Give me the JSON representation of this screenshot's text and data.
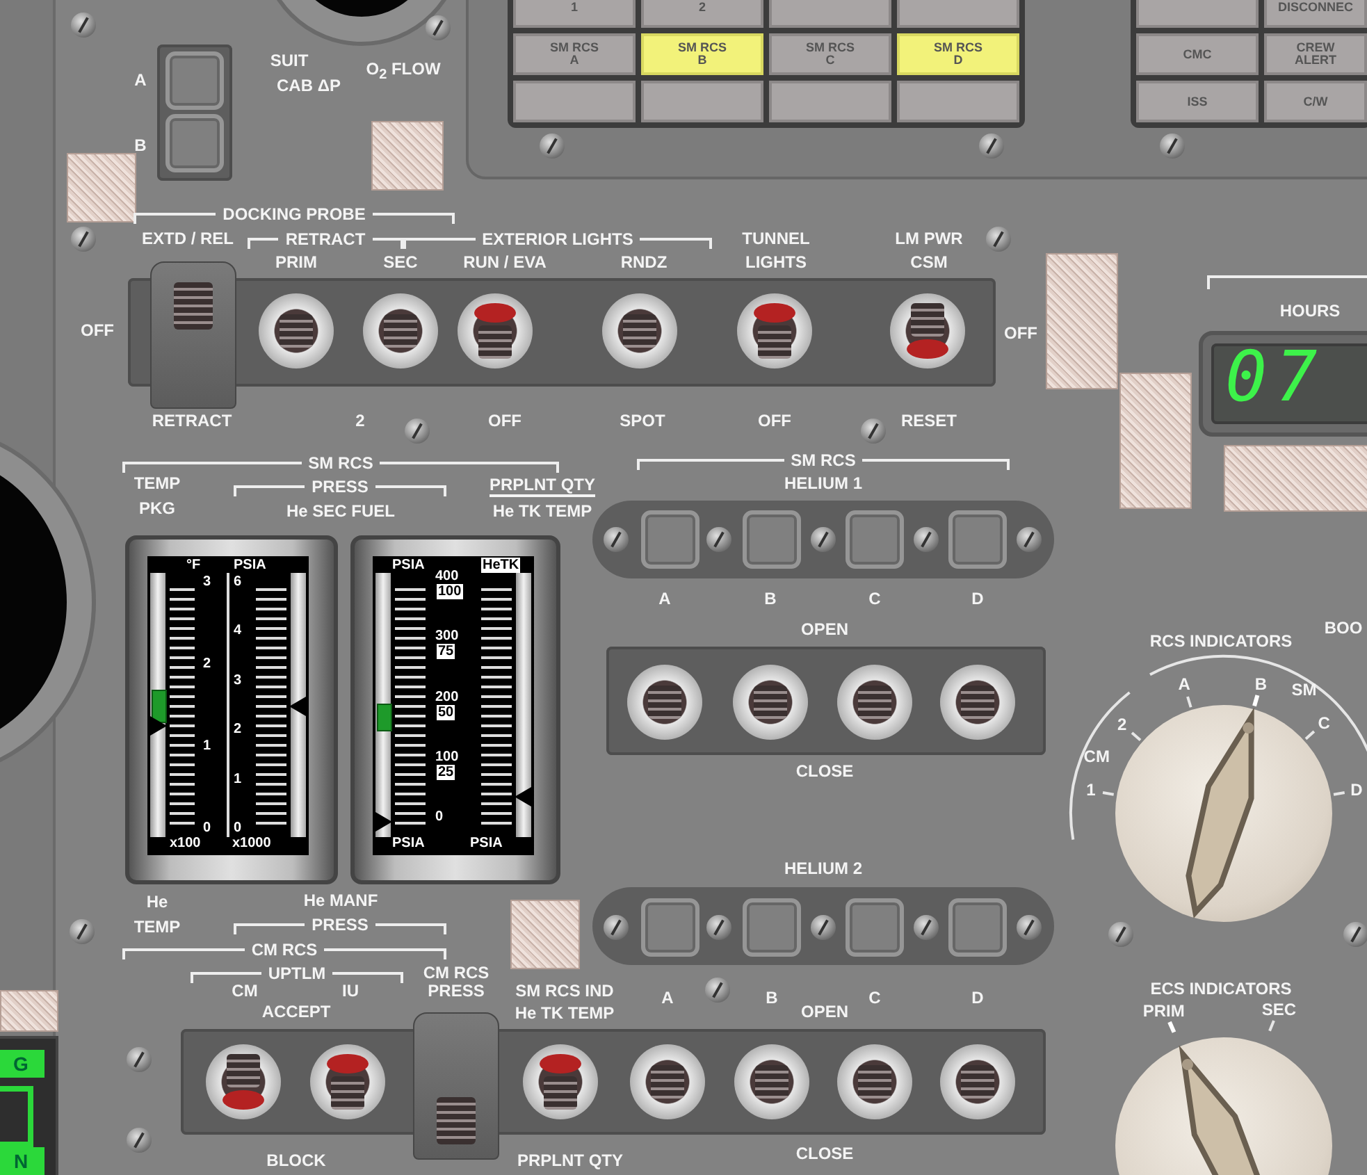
{
  "caution_warning_lights": {
    "left": [
      [
        {
          "label": "1",
          "lit": false
        },
        {
          "label": "2",
          "lit": false
        },
        {
          "lit": false
        },
        {
          "lit": false
        }
      ],
      [
        {
          "label": "SM RCS\nA",
          "lit": false
        },
        {
          "label": "SM RCS\nB",
          "lit": true
        },
        {
          "label": "SM RCS\nC",
          "lit": false
        },
        {
          "label": "SM RCS\nD",
          "lit": true
        }
      ],
      [
        {
          "lit": false
        },
        {
          "lit": false
        },
        {
          "lit": false
        },
        {
          "lit": false
        }
      ]
    ],
    "right": [
      [
        {
          "lit": false
        },
        {
          "label": "DISCONNEC",
          "lit": false
        }
      ],
      [
        {
          "label": "CMC",
          "lit": false
        },
        {
          "label": "CREW\nALERT",
          "lit": false
        }
      ],
      [
        {
          "label": "ISS",
          "lit": false
        },
        {
          "label": "C/W",
          "lit": false
        }
      ]
    ]
  },
  "labels": [
    {
      "text": "A"
    },
    {
      "text": "B"
    },
    {
      "text": "SUIT"
    },
    {
      "text": "CAB ΔP"
    },
    {
      "text": "O$_{2}$ FLOW"
    },
    {
      "text": "DOCKING PROBE",
      "bracketed": true
    },
    {
      "text": "EXTD / REL"
    },
    {
      "text": "RETRACT",
      "bracketed": true
    },
    {
      "text": "EXTERIOR LIGHTS",
      "bracketed": true
    },
    {
      "text": "TUNNEL"
    },
    {
      "text": "LM PWR"
    },
    {
      "text": "PRIM"
    },
    {
      "text": "SEC"
    },
    {
      "text": "RUN / EVA"
    },
    {
      "text": "RNDZ"
    },
    {
      "text": "LIGHTS"
    },
    {
      "text": "CSM"
    },
    {
      "text": "OFF"
    },
    {
      "text": "OFF"
    },
    {
      "text": "RETRACT"
    },
    {
      "text": "2"
    },
    {
      "text": "OFF"
    },
    {
      "text": "SPOT"
    },
    {
      "text": "OFF"
    },
    {
      "text": "RESET"
    },
    {
      "text": "SM RCS",
      "bracketed": true
    },
    {
      "text": "SM RCS",
      "bracketed": true
    },
    {
      "text": "TEMP"
    },
    {
      "text": "PRESS",
      "bracketed": true
    },
    {
      "text": "PRPLNT QTY",
      "underlined": true
    },
    {
      "text": "HELIUM 1"
    },
    {
      "text": "PKG"
    },
    {
      "text": "He SEC FUEL"
    },
    {
      "text": "He TK TEMP"
    },
    {
      "text": "A"
    },
    {
      "text": "B"
    },
    {
      "text": "C"
    },
    {
      "text": "D"
    },
    {
      "text": "OPEN"
    },
    {
      "text": "BOO"
    },
    {
      "text": "CLOSE"
    },
    {
      "text": "HELIUM 2"
    },
    {
      "text": "He"
    },
    {
      "text": "He MANF"
    },
    {
      "text": "TEMP"
    },
    {
      "text": "PRESS",
      "bracketed": true
    },
    {
      "text": "CM RCS",
      "bracketed": true
    },
    {
      "text": "UPTLM",
      "bracketed": true
    },
    {
      "text": "CM RCS"
    },
    {
      "text": "CM"
    },
    {
      "text": "IU"
    },
    {
      "text": "PRESS"
    },
    {
      "text": "SM RCS IND"
    },
    {
      "text": "A"
    },
    {
      "text": "B"
    },
    {
      "text": "C"
    },
    {
      "text": "D"
    },
    {
      "text": "ACCEPT"
    },
    {
      "text": "He TK TEMP"
    },
    {
      "text": "OPEN"
    },
    {
      "text": "CLOSE"
    },
    {
      "text": "BLOCK"
    },
    {
      "text": "PRPLNT QTY"
    }
  ],
  "talkback_indicators": [
    {
      "barber_pole": false
    },
    {
      "barber_pole": false
    },
    {
      "barber_pole": false
    },
    {
      "barber_pole": false
    },
    {
      "barber_pole": false
    },
    {
      "barber_pole": false
    },
    {
      "barber_pole": false
    },
    {
      "barber_pole": false
    },
    {
      "barber_pole": false
    },
    {
      "barber_pole": false
    }
  ],
  "switches": [
    {
      "kind": "guarded",
      "up": true,
      "down": false
    },
    {
      "kind": "toggle",
      "up": false,
      "down": false
    },
    {
      "kind": "toggle",
      "up": false,
      "down": false
    },
    {
      "kind": "toggle",
      "up": false,
      "down": true
    },
    {
      "kind": "toggle",
      "up": false,
      "down": false
    },
    {
      "kind": "toggle",
      "up": false,
      "down": true
    },
    {
      "kind": "toggle",
      "up": true,
      "down": false
    },
    {
      "kind": "toggle",
      "up": false,
      "down": false
    },
    {
      "kind": "toggle",
      "up": false,
      "down": false
    },
    {
      "kind": "toggle",
      "up": false,
      "down": false
    },
    {
      "kind": "toggle",
      "up": false,
      "down": false
    },
    {
      "kind": "toggle",
      "up": true,
      "down": false
    },
    {
      "kind": "toggle",
      "up": false,
      "down": true
    },
    {
      "kind": "guarded",
      "up": false,
      "down": true
    },
    {
      "kind": "toggle",
      "up": false,
      "down": true
    },
    {
      "kind": "toggle",
      "up": false,
      "down": false
    },
    {
      "kind": "toggle",
      "up": false,
      "down": false
    },
    {
      "kind": "toggle",
      "up": false,
      "down": false
    },
    {
      "kind": "toggle",
      "up": false,
      "down": false
    }
  ],
  "gauges": [
    {
      "kind": "dual",
      "scales": [
        {
          "unit": "°F",
          "ticks": [
            "3",
            "2",
            "1",
            "0"
          ],
          "footer": "x100",
          "level": 0.41
        },
        {
          "unit": "PSIA",
          "ticks": [
            "6",
            "4",
            "3",
            "2",
            "1",
            "0"
          ],
          "footer": "x1000",
          "level": 0.49
        }
      ]
    },
    {
      "kind": "stacked",
      "scales": [
        {
          "unit": "PSIA",
          "ticks": [
            "400",
            "300",
            "200",
            "100",
            "0"
          ],
          "footer": "PSIA",
          "level": 0.02
        },
        {
          "unit": "HeTK",
          "ticks": [
            "100",
            "75",
            "50",
            "25"
          ],
          "footer": "PSIA",
          "level": 0.125
        }
      ]
    }
  ],
  "hours_display": {
    "label": "HOURS",
    "digits": "07"
  },
  "rcs_indicators": {
    "title": "RCS INDICATORS",
    "groups": [
      "CM",
      "SM"
    ],
    "positions": [
      {
        "label": "1",
        "selected": false
      },
      {
        "label": "2",
        "selected": false
      },
      {
        "label": "A",
        "selected": false
      },
      {
        "label": "B",
        "selected": true
      },
      {
        "label": "C",
        "selected": false
      },
      {
        "label": "D",
        "selected": false
      }
    ]
  },
  "ecs_indicators": {
    "title": "ECS INDICATORS",
    "positions": [
      {
        "label": "PRIM",
        "selected": true
      },
      {
        "label": "SEC",
        "selected": false
      }
    ]
  },
  "edge_display": {
    "lamps": [
      {
        "label": "G",
        "lit": true
      },
      {
        "label": "N",
        "lit": true
      }
    ]
  }
}
